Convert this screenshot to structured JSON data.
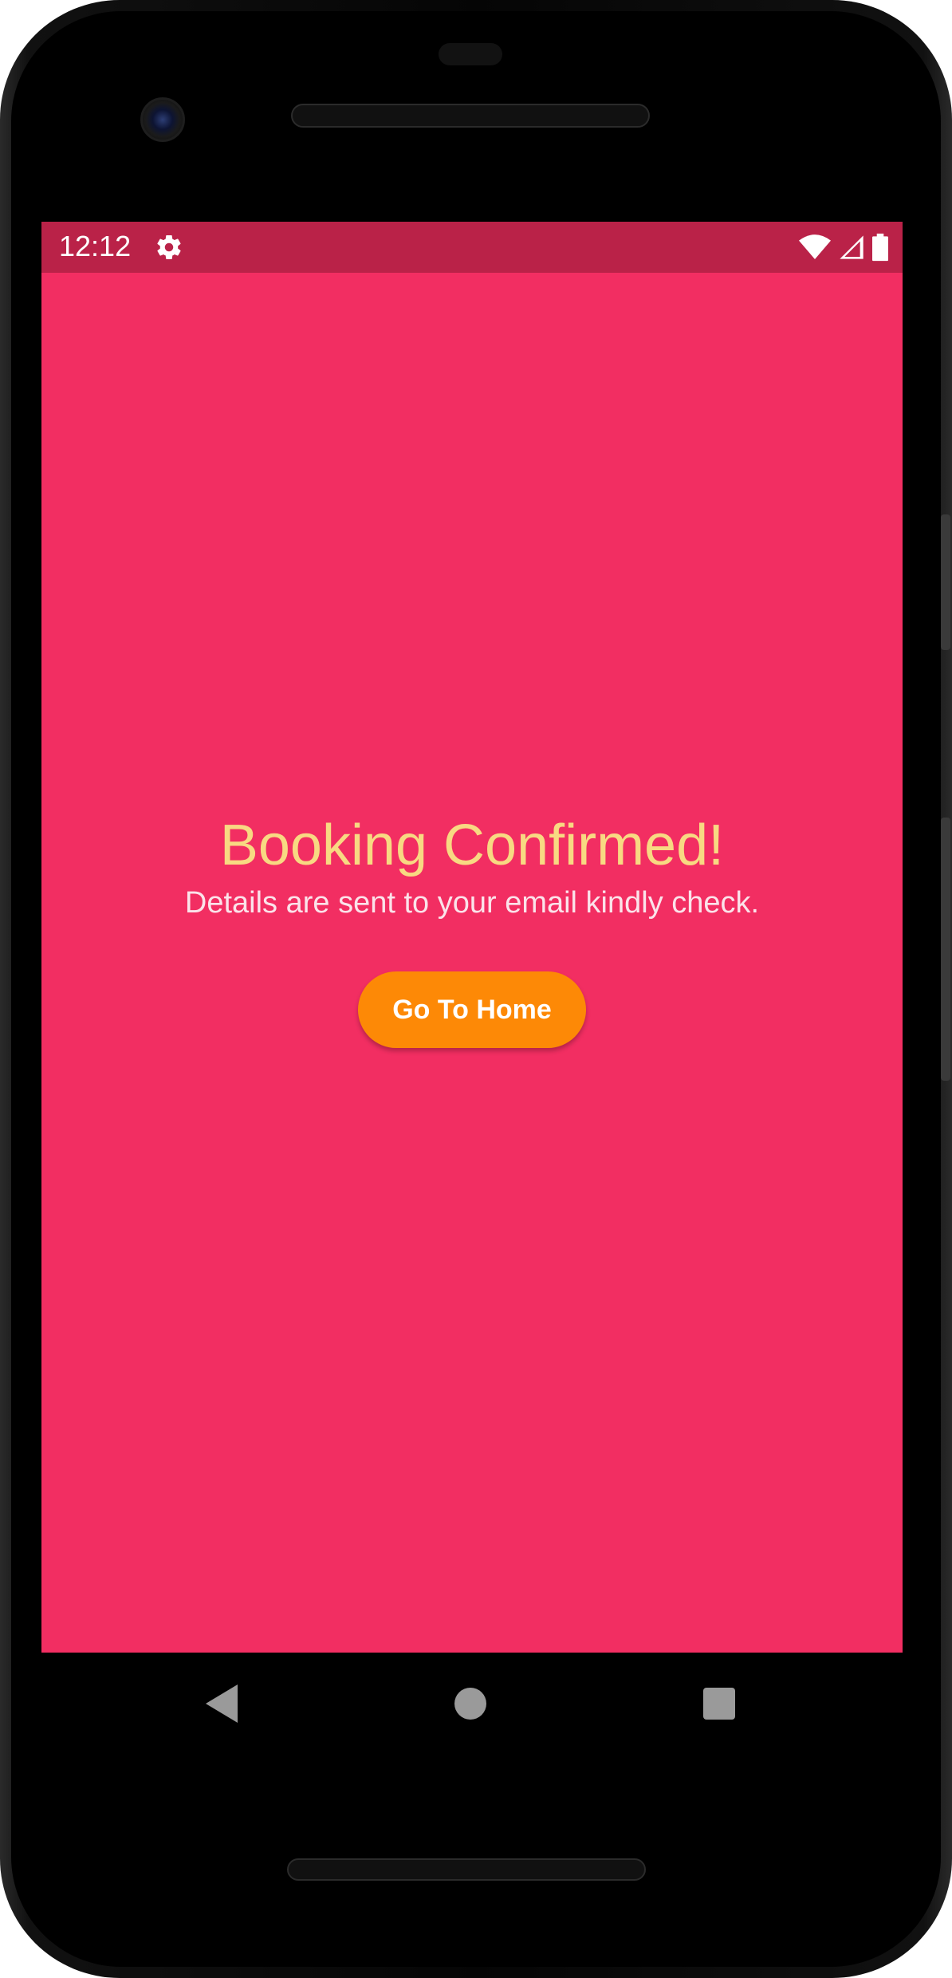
{
  "status_bar": {
    "time": "12:12",
    "icons": [
      "gear-icon",
      "wifi-icon",
      "signal-icon",
      "battery-icon"
    ]
  },
  "confirmation": {
    "title": "Booking Confirmed!",
    "message": "Details are sent to your email kindly check.",
    "button_label": "Go To Home"
  },
  "nav_bar": {
    "icons": [
      "back-icon",
      "home-icon",
      "recents-icon"
    ]
  },
  "colors": {
    "screen_background": "#f22e62",
    "status_bar": "#ba2248",
    "title": "#f8d982",
    "button": "#fd8906",
    "button_text": "#ffffff"
  }
}
